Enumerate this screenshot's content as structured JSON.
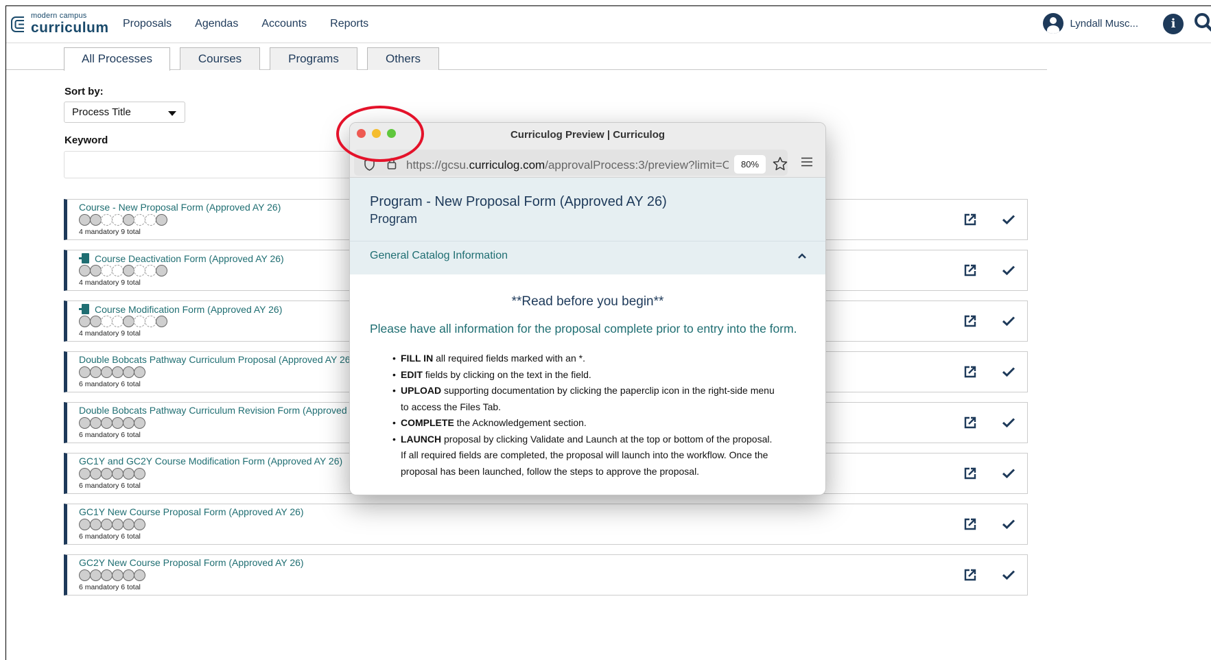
{
  "header": {
    "logo_small": "modern campus",
    "logo_big": "curriculum",
    "nav": [
      "Proposals",
      "Agendas",
      "Accounts",
      "Reports"
    ],
    "user_name": "Lyndall Musc...",
    "info_glyph": "i"
  },
  "tabs": [
    "All Processes",
    "Courses",
    "Programs",
    "Others"
  ],
  "sort": {
    "label": "Sort by:",
    "value": "Process Title"
  },
  "keyword": {
    "label": "Keyword",
    "value": ""
  },
  "processes": [
    {
      "title": "Course - New Proposal Form (Approved AY 26)",
      "has_doc_icon": false,
      "steps": [
        "m",
        "m",
        "o",
        "o",
        "m",
        "o",
        "o",
        "m"
      ],
      "summary": "4 mandatory 9 total"
    },
    {
      "title": "Course Deactivation Form (Approved AY 26)",
      "has_doc_icon": true,
      "steps": [
        "m",
        "m",
        "o",
        "o",
        "m",
        "o",
        "o",
        "m"
      ],
      "summary": "4 mandatory 9 total"
    },
    {
      "title": "Course Modification Form (Approved AY 26)",
      "has_doc_icon": true,
      "steps": [
        "m",
        "m",
        "o",
        "o",
        "m",
        "o",
        "o",
        "m"
      ],
      "summary": "4 mandatory 9 total"
    },
    {
      "title": "Double Bobcats Pathway Curriculum Proposal (Approved AY 26)",
      "has_doc_icon": false,
      "steps": [
        "m",
        "m",
        "m",
        "m",
        "m",
        "m"
      ],
      "summary": "6 mandatory 6 total"
    },
    {
      "title": "Double Bobcats Pathway Curriculum Revision Form (Approved AY 26",
      "has_doc_icon": false,
      "steps": [
        "m",
        "m",
        "m",
        "m",
        "m",
        "m"
      ],
      "summary": "6 mandatory 6 total"
    },
    {
      "title": "GC1Y and GC2Y Course Modification Form (Approved AY 26)",
      "has_doc_icon": false,
      "steps": [
        "m",
        "m",
        "m",
        "m",
        "m",
        "m"
      ],
      "summary": "6 mandatory 6 total"
    },
    {
      "title": "GC1Y New Course Proposal Form (Approved AY 26)",
      "has_doc_icon": false,
      "steps": [
        "m",
        "m",
        "m",
        "m",
        "m",
        "m"
      ],
      "summary": "6 mandatory 6 total"
    },
    {
      "title": "GC2Y New Course Proposal Form (Approved AY 26)",
      "has_doc_icon": false,
      "steps": [
        "m",
        "m",
        "m",
        "m",
        "m",
        "m"
      ],
      "summary": "6 mandatory 6 total"
    }
  ],
  "preview_window": {
    "title": "Curriculog Preview | Curriculog",
    "url_prefix": "https://gcsu.",
    "url_domain": "curriculog.com",
    "url_path": "/approvalProcess:3/preview?limit=C",
    "zoom": "80%",
    "program_title": "Program - New Proposal Form (Approved AY 26)",
    "program_type": "Program",
    "section_title": "General Catalog Information",
    "read_heading": "**Read before you begin**",
    "intro": "Please have all information for the proposal complete prior to entry into the form.",
    "bullets": [
      {
        "bold": "FILL IN",
        "text": " all required fields marked with an *."
      },
      {
        "bold": "EDIT",
        "text": " fields by clicking on the text in the field."
      },
      {
        "bold": "UPLOAD",
        "text": " supporting documentation by clicking the paperclip icon in the right-side menu to access the Files Tab."
      },
      {
        "bold": "COMPLETE",
        "text": " the Acknowledgement section."
      },
      {
        "bold": "LAUNCH",
        "text": " proposal by clicking Validate and Launch at the top or bottom of the proposal.  If all required fields are completed, the proposal will launch into the workflow. Once the proposal has been launched, follow the steps to approve the proposal."
      }
    ]
  },
  "colors": {
    "navy": "#1e3a5a",
    "teal": "#1f6e72",
    "traffic_red": "#ee5a52",
    "traffic_yellow": "#f5bd2f",
    "traffic_green": "#5fc73d",
    "annotation_red": "#e4122a"
  },
  "icons": [
    "logo-icon",
    "avatar-icon",
    "info-icon",
    "search-icon",
    "document-icon",
    "external-link-icon",
    "check-icon",
    "shield-icon",
    "lock-icon",
    "star-icon",
    "hamburger-menu-icon",
    "chevron-up-icon"
  ]
}
